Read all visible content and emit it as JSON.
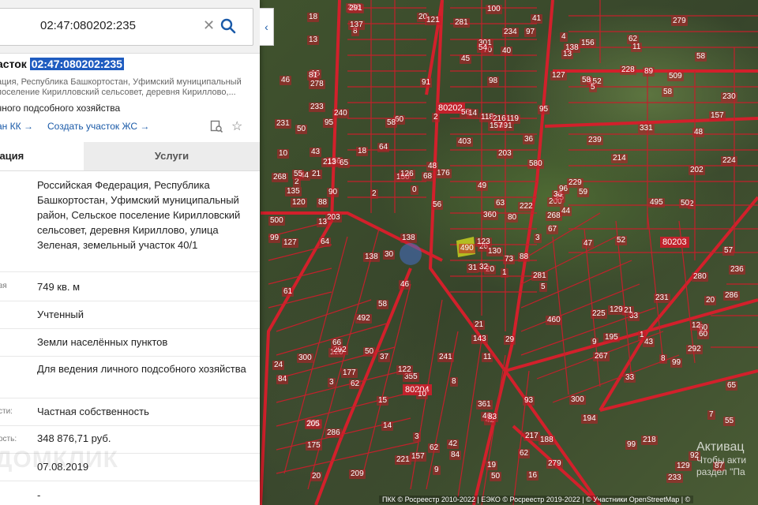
{
  "search": {
    "value": "02:47:080202:235",
    "placeholder": ""
  },
  "title": {
    "prefix": "асток",
    "cadastral": "02:47:080202:235"
  },
  "summary": {
    "address": "ация, Республика Башкортостан, Уфимский муниципальный поселение Кирилловский сельсовет, деревня Кириллово,...",
    "purpose": "чного подсобного хозяйства",
    "link_kk": "ан КК →",
    "link_create": "Создать участок ЖС →"
  },
  "tabs": {
    "info": "мация",
    "services": "Услуги"
  },
  "rows": [
    {
      "label": "",
      "value": "Российская Федерация, Республика Башкортостан, Уфимский муниципальный район, Сельское поселение Кирилловский сельсовет, деревня Кириллово, улица Зеленая, земельный участок 40/1"
    },
    {
      "label": "вя",
      "value": "749 кв. м"
    },
    {
      "label": "",
      "value": "Учтенный"
    },
    {
      "label": "",
      "value": "Земли населённых пунктов"
    },
    {
      "label": "",
      "value": "Для ведения личного подсобного хозяйства"
    },
    {
      "label": "сти:",
      "value": "Частная собственность"
    },
    {
      "label": "ость:",
      "value": "348 876,71 руб."
    },
    {
      "label": "",
      "value": "07.08.2019"
    },
    {
      "label": "",
      "value": "-"
    }
  ],
  "watermark": "ДОМКЛИК",
  "map": {
    "quarters": [
      "80202",
      "80203",
      "80204"
    ],
    "labels": [
      "1",
      "95",
      "26",
      "201",
      "200",
      "355",
      "156",
      "119",
      "152",
      "3",
      "8",
      "87",
      "203",
      "230",
      "31",
      "239",
      "209",
      "118",
      "580",
      "177",
      "176",
      "175",
      "14",
      "216",
      "25",
      "33",
      "240",
      "70",
      "120",
      "225",
      "224",
      "123",
      "361",
      "360",
      "60",
      "228",
      "122",
      "129",
      "7",
      "21",
      "41",
      "68",
      "2",
      "267",
      "221",
      "268",
      "268",
      "20",
      "42",
      "67",
      "3",
      "48",
      "46",
      "195",
      "194",
      "15",
      "137",
      "18",
      "93",
      "509",
      "234",
      "138",
      "44",
      "64",
      "89",
      "266",
      "138",
      "45",
      "63",
      "24",
      "11",
      "62",
      "129",
      "150",
      "205",
      "13",
      "18",
      "61",
      "49",
      "217",
      "222",
      "286",
      "47",
      "60",
      "19",
      "2",
      "29",
      "218",
      "16",
      "300",
      "301",
      "236",
      "59",
      "33",
      "80",
      "292",
      "2",
      "50",
      "58",
      "5",
      "138",
      "20",
      "57",
      "135",
      "492",
      "37",
      "3",
      "36",
      "58",
      "56",
      "280",
      "278",
      "491",
      "490",
      "121",
      "300",
      "20",
      "58",
      "56",
      "281",
      "120",
      "279",
      "36",
      "2",
      "52",
      "58",
      "92",
      "84",
      "495",
      "233",
      "292",
      "279",
      "126",
      "91",
      "20",
      "43",
      "46",
      "66",
      "286",
      "48",
      "281",
      "90",
      "8",
      "88",
      "96",
      "16",
      "42",
      "99",
      "46",
      "54",
      "202",
      "58",
      "55",
      "9",
      "231",
      "97",
      "98",
      "203",
      "30",
      "95",
      "460",
      "40",
      "99",
      "100",
      "13",
      "43",
      "21",
      "55",
      "291",
      "233",
      "99",
      "188",
      "10",
      "4",
      "229",
      "157",
      "127",
      "9",
      "231",
      "156",
      "50",
      "73",
      "62",
      "21",
      "81",
      "65",
      "213",
      "88",
      "10",
      "130",
      "12",
      "241",
      "157",
      "331",
      "44",
      "83",
      "64",
      "14",
      "1",
      "50",
      "13",
      "62",
      "403",
      "500",
      "214",
      "127",
      "32",
      "84",
      "143",
      "11",
      "65",
      "157",
      "0",
      "60",
      "50",
      "8",
      "62",
      "5"
    ],
    "activation_title": "Активац",
    "activation_line1": "Чтобы акти",
    "activation_line2": "раздел \"Па",
    "copyright": "ПКК © Росреестр 2010-2022 | ЕЭКО © Росреестр 2019-2022 | © Участники OpenStreetMap | ©"
  }
}
